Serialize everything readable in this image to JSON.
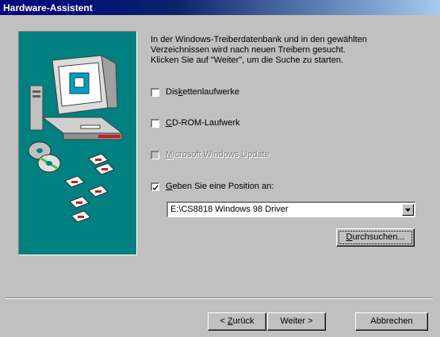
{
  "window": {
    "title": "Hardware-Assistent"
  },
  "info_text": [
    "In der Windows-Treiberdatenbank und in den gewählten",
    "Verzeichnissen wird nach neuen Treibern gesucht.",
    "Klicken Sie auf \"Weiter\", um die Suche zu starten."
  ],
  "options": {
    "floppy": {
      "pre": "Dis",
      "key": "k",
      "post": "ettenlaufwerke",
      "checked": false,
      "enabled": true
    },
    "cdrom": {
      "pre": "",
      "key": "C",
      "post": "D-ROM-Laufwerk",
      "checked": false,
      "enabled": true
    },
    "windows_update": {
      "pre": "",
      "key": "M",
      "post": "icrosoft Windows Update",
      "checked": false,
      "enabled": false
    },
    "position": {
      "pre": "",
      "key": "G",
      "post": "eben Sie eine Position an:",
      "checked": true,
      "enabled": true
    }
  },
  "location_combo": {
    "value": "E:\\CS8818 Windows 98 Driver"
  },
  "buttons": {
    "browse": {
      "key": "D",
      "rest": "urchsuchen..."
    },
    "back": {
      "pre": "< ",
      "key": "Z",
      "rest": "urück"
    },
    "next": {
      "label": "Weiter >"
    },
    "cancel": {
      "label": "Abbrechen"
    }
  },
  "icons": [
    "computer-icon",
    "cd-icon",
    "floppy-disk-icon",
    "dropdown-arrow-icon",
    "checkmark-icon"
  ]
}
